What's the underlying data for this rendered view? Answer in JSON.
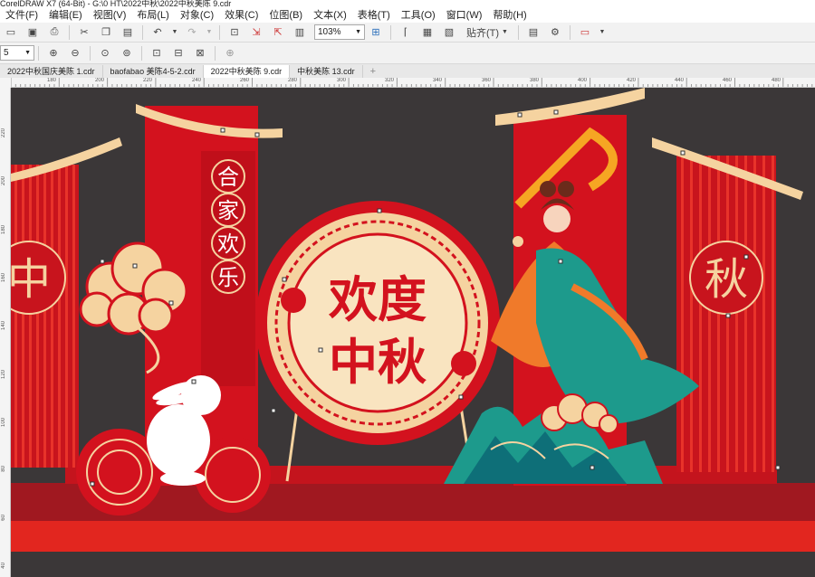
{
  "window": {
    "title": "CorelDRAW X7 (64-Bit) - G:\\0 HT\\2022中秋\\2022中秋美陈 9.cdr"
  },
  "menu": [
    "文件(F)",
    "编辑(E)",
    "视图(V)",
    "布局(L)",
    "对象(C)",
    "效果(C)",
    "位图(B)",
    "文本(X)",
    "表格(T)",
    "工具(O)",
    "窗口(W)",
    "帮助(H)"
  ],
  "toolbar": {
    "zoom": "103%",
    "snap_label": "贴齐(T)",
    "size_value": "5"
  },
  "tabs": [
    {
      "label": "2022中秋国庆美陈 1.cdr",
      "active": false
    },
    {
      "label": "baofabao 美陈4-5-2.cdr",
      "active": false
    },
    {
      "label": "2022中秋美陈 9.cdr",
      "active": true
    },
    {
      "label": "中秋美陈 13.cdr",
      "active": false
    }
  ],
  "ruler": {
    "h_ticks": [
      "180",
      "200",
      "220",
      "240",
      "260",
      "280",
      "300",
      "320",
      "340",
      "360",
      "380",
      "400",
      "420",
      "440",
      "460",
      "480"
    ],
    "v_ticks": [
      "220",
      "200",
      "180",
      "160",
      "140",
      "120",
      "100",
      "80",
      "60",
      "40"
    ]
  },
  "artwork": {
    "banner_chars": [
      "合",
      "家",
      "欢",
      "乐"
    ],
    "main_chars_line1": "欢度",
    "main_chars_line2": "中秋",
    "left_char": "中",
    "right_char": "秋",
    "colors": {
      "red": "#d3121e",
      "dark_red": "#a01820",
      "gold": "#f5d3a0",
      "bg": "#3b3738",
      "teal": "#1d9a8c"
    }
  }
}
